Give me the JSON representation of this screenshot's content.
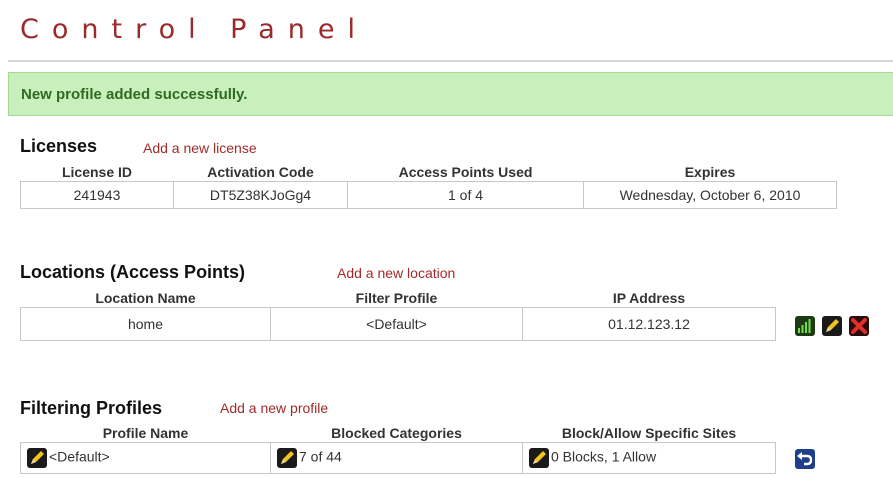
{
  "page": {
    "title": "Control Panel"
  },
  "message": {
    "text": "New profile added successfully."
  },
  "licenses": {
    "title": "Licenses",
    "add_link": "Add a new license",
    "columns": [
      "License ID",
      "Activation Code",
      "Access Points Used",
      "Expires"
    ],
    "rows": [
      [
        "241943",
        "DT5Z38KJoGg4",
        "1 of 4",
        "Wednesday, October 6, 2010"
      ]
    ]
  },
  "locations": {
    "title": "Locations (Access Points)",
    "add_link": "Add a new location",
    "columns": [
      "Location Name",
      "Filter Profile",
      "IP Address"
    ],
    "rows": [
      [
        "home",
        "<Default>",
        "01.12.123.12"
      ]
    ],
    "row_actions": [
      "signal-icon",
      "edit-icon",
      "delete-icon"
    ]
  },
  "profiles": {
    "title": "Filtering Profiles",
    "add_link": "Add a new profile",
    "columns": [
      "Profile Name",
      "Blocked Categories",
      "Block/Allow Specific Sites"
    ],
    "rows": [
      [
        "<Default>",
        "7 of 44",
        "0 Blocks, 1 Allow"
      ]
    ],
    "row_actions": [
      "undo-icon"
    ]
  },
  "colors": {
    "title": "#9b2b2b",
    "link": "#a32a2a",
    "success_bg": "#c9efbd",
    "success_text": "#2f6b23"
  }
}
